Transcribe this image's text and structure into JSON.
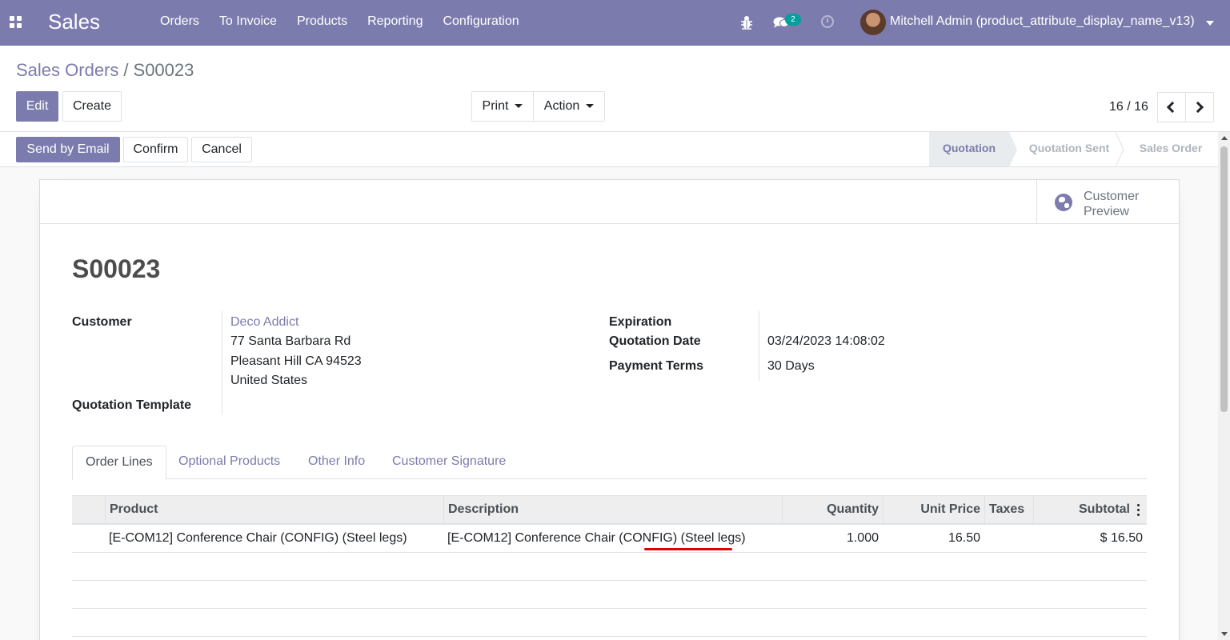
{
  "navbar": {
    "app_name": "Sales",
    "menu": [
      "Orders",
      "To Invoice",
      "Products",
      "Reporting",
      "Configuration"
    ],
    "chat_count": "2",
    "user_name": "Mitchell Admin (product_attribute_display_name_v13)"
  },
  "breadcrumb": {
    "parent": "Sales Orders",
    "separator": "/",
    "current": "S00023"
  },
  "buttons": {
    "edit": "Edit",
    "create": "Create",
    "print": "Print",
    "action": "Action",
    "send_by_email": "Send by Email",
    "confirm": "Confirm",
    "cancel": "Cancel"
  },
  "pager": {
    "value": "16 / 16"
  },
  "stages": [
    "Quotation",
    "Quotation Sent",
    "Sales Order"
  ],
  "active_stage": "Quotation",
  "stat_button": {
    "line1": "Customer",
    "line2": "Preview"
  },
  "record": {
    "name": "S00023",
    "customer_label": "Customer",
    "customer_name": "Deco Addict",
    "address_line1": "77 Santa Barbara Rd",
    "address_line2": "Pleasant Hill CA 94523",
    "address_line3": "United States",
    "quotation_template_label": "Quotation Template",
    "expiration_label": "Expiration",
    "quotation_date_label": "Quotation Date",
    "quotation_date": "03/24/2023 14:08:02",
    "payment_terms_label": "Payment Terms",
    "payment_terms": "30 Days"
  },
  "tabs": [
    "Order Lines",
    "Optional Products",
    "Other Info",
    "Customer Signature"
  ],
  "table": {
    "headers": {
      "product": "Product",
      "description": "Description",
      "quantity": "Quantity",
      "unit_price": "Unit Price",
      "taxes": "Taxes",
      "subtotal": "Subtotal"
    },
    "rows": [
      {
        "product": "[E-COM12] Conference Chair (CONFIG) (Steel legs)",
        "description": "[E-COM12] Conference Chair (CONFIG) (Steel legs)",
        "quantity": "1.000",
        "unit_price": "16.50",
        "taxes": "",
        "subtotal": "$ 16.50"
      }
    ]
  },
  "colors": {
    "brand": "#7c7bad",
    "annotation": "#e00000"
  }
}
